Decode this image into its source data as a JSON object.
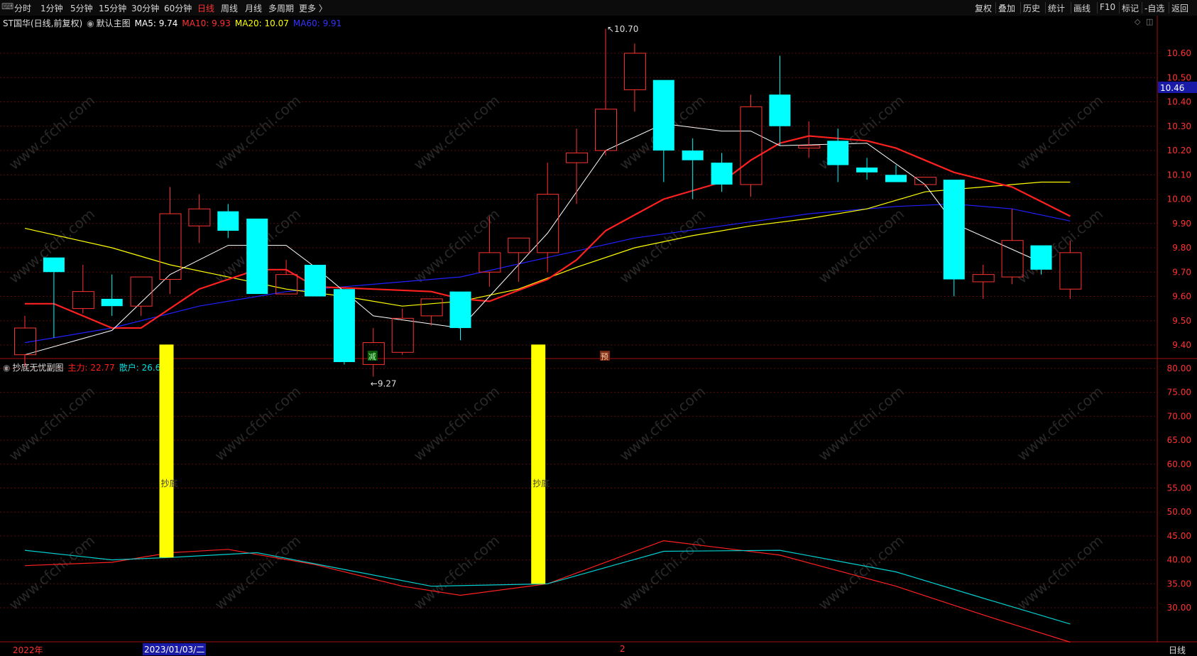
{
  "toolbar": {
    "periods": [
      "分时",
      "1分钟",
      "5分钟",
      "15分钟",
      "30分钟",
      "60分钟",
      "日线",
      "周线",
      "月线",
      "多周期",
      "更多 〉"
    ],
    "active_period": "日线",
    "right_buttons": [
      "复权",
      "叠加",
      "历史",
      "统计",
      "画线",
      "F10",
      "标记",
      "-自选",
      "返回"
    ]
  },
  "main_header": {
    "title": "ST国华(日线,前复权)",
    "chart_name": "默认主图",
    "ma5": "MA5: 9.74",
    "ma10": "MA10: 9.93",
    "ma20": "MA20: 10.07",
    "ma60": "MA60: 9.91"
  },
  "sub_header": {
    "title": "抄底无忧副图",
    "main_force": "主力: 22.77",
    "retail": "散户: 26.62"
  },
  "main_axis_ticks": [
    "10.60",
    "10.50",
    "10.40",
    "10.30",
    "10.20",
    "10.10",
    "10.00",
    "9.90",
    "9.80",
    "9.70",
    "9.60",
    "9.50",
    "9.40"
  ],
  "current_price": "10.46",
  "sub_axis_ticks": [
    "80.00",
    "75.00",
    "70.00",
    "65.00",
    "60.00",
    "55.00",
    "50.00",
    "45.00",
    "40.00",
    "35.00",
    "30.00"
  ],
  "annotations": {
    "high": "10.70",
    "low": "9.27",
    "marker_jian": "减",
    "marker_yu": "预",
    "signal_label": "抄底"
  },
  "date_axis": {
    "year": "2022年",
    "cursor_date": "2023/01/03/二",
    "month": "2"
  },
  "bottom_tab": "日线",
  "watermark": "www.cfchi.com",
  "colors": {
    "up": "#ff3232",
    "down": "#00ffff",
    "ma5": "#ffffff",
    "ma10": "#ff2020",
    "ma20": "#ffff00",
    "ma60": "#2020ff",
    "signal": "#ffff00"
  },
  "chart_data": {
    "type": "candlestick",
    "candles": [
      {
        "o": 9.36,
        "c": 9.47,
        "h": 9.52,
        "l": 9.31
      },
      {
        "o": 9.76,
        "c": 9.7,
        "h": 9.76,
        "l": 9.43
      },
      {
        "o": 9.55,
        "c": 9.62,
        "h": 9.73,
        "l": 9.53
      },
      {
        "o": 9.59,
        "c": 9.56,
        "h": 9.69,
        "l": 9.52
      },
      {
        "o": 9.56,
        "c": 9.68,
        "h": 9.68,
        "l": 9.52
      },
      {
        "o": 9.67,
        "c": 9.94,
        "h": 10.05,
        "l": 9.61
      },
      {
        "o": 9.89,
        "c": 9.96,
        "h": 10.02,
        "l": 9.82
      },
      {
        "o": 9.95,
        "c": 9.87,
        "h": 9.98,
        "l": 9.84
      },
      {
        "o": 9.92,
        "c": 9.61,
        "h": 9.92,
        "l": 9.61
      },
      {
        "o": 9.61,
        "c": 9.69,
        "h": 9.75,
        "l": 9.61
      },
      {
        "o": 9.73,
        "c": 9.6,
        "h": 9.73,
        "l": 9.6
      },
      {
        "o": 9.63,
        "c": 9.33,
        "h": 9.63,
        "l": 9.32
      },
      {
        "o": 9.32,
        "c": 9.41,
        "h": 9.47,
        "l": 9.27
      },
      {
        "o": 9.37,
        "c": 9.51,
        "h": 9.55,
        "l": 9.36
      },
      {
        "o": 9.52,
        "c": 9.59,
        "h": 9.59,
        "l": 9.48
      },
      {
        "o": 9.62,
        "c": 9.47,
        "h": 9.62,
        "l": 9.42
      },
      {
        "o": 9.7,
        "c": 9.78,
        "h": 9.93,
        "l": 9.64
      },
      {
        "o": 9.78,
        "c": 9.84,
        "h": 9.84,
        "l": 9.66
      },
      {
        "o": 9.78,
        "c": 10.02,
        "h": 10.15,
        "l": 9.7
      },
      {
        "o": 10.15,
        "c": 10.19,
        "h": 10.29,
        "l": 9.98
      },
      {
        "o": 10.2,
        "c": 10.37,
        "h": 10.7,
        "l": 10.18
      },
      {
        "o": 10.45,
        "c": 10.6,
        "h": 10.64,
        "l": 10.36
      },
      {
        "o": 10.49,
        "c": 10.2,
        "h": 10.49,
        "l": 10.07
      },
      {
        "o": 10.2,
        "c": 10.16,
        "h": 10.25,
        "l": 10.0
      },
      {
        "o": 10.15,
        "c": 10.06,
        "h": 10.19,
        "l": 10.03
      },
      {
        "o": 10.06,
        "c": 10.38,
        "h": 10.43,
        "l": 10.01
      },
      {
        "o": 10.43,
        "c": 10.3,
        "h": 10.59,
        "l": 10.22
      },
      {
        "o": 10.21,
        "c": 10.22,
        "h": 10.32,
        "l": 10.17
      },
      {
        "o": 10.24,
        "c": 10.14,
        "h": 10.29,
        "l": 10.07
      },
      {
        "o": 10.13,
        "c": 10.11,
        "h": 10.17,
        "l": 10.08
      },
      {
        "o": 10.1,
        "c": 10.07,
        "h": 10.14,
        "l": 10.07
      },
      {
        "o": 10.06,
        "c": 10.09,
        "h": 10.09,
        "l": 10.05
      },
      {
        "o": 10.08,
        "c": 9.67,
        "h": 10.08,
        "l": 9.6
      },
      {
        "o": 9.66,
        "c": 9.69,
        "h": 9.73,
        "l": 9.59
      },
      {
        "o": 9.68,
        "c": 9.83,
        "h": 9.96,
        "l": 9.65
      },
      {
        "o": 9.81,
        "c": 9.71,
        "h": 9.81,
        "l": 9.69
      },
      {
        "o": 9.63,
        "c": 9.78,
        "h": 9.83,
        "l": 9.59
      }
    ],
    "ma5": [
      [
        0,
        9.36
      ],
      [
        3,
        9.46
      ],
      [
        5,
        9.69
      ],
      [
        7,
        9.81
      ],
      [
        9,
        9.81
      ],
      [
        10,
        9.72
      ],
      [
        12,
        9.52
      ],
      [
        15,
        9.47
      ],
      [
        16,
        9.6
      ],
      [
        18,
        9.86
      ],
      [
        20,
        10.2
      ],
      [
        22,
        10.31
      ],
      [
        24,
        10.28
      ],
      [
        25,
        10.28
      ],
      [
        26,
        10.22
      ],
      [
        29,
        10.23
      ],
      [
        31,
        10.06
      ],
      [
        32,
        9.9
      ],
      [
        35,
        9.74
      ]
    ],
    "ma10": [
      [
        0,
        9.57
      ],
      [
        1,
        9.57
      ],
      [
        3,
        9.47
      ],
      [
        4,
        9.47
      ],
      [
        6,
        9.63
      ],
      [
        8,
        9.71
      ],
      [
        9,
        9.71
      ],
      [
        10,
        9.64
      ],
      [
        12,
        9.63
      ],
      [
        14,
        9.62
      ],
      [
        15,
        9.59
      ],
      [
        16,
        9.58
      ],
      [
        18,
        9.67
      ],
      [
        19,
        9.75
      ],
      [
        20,
        9.87
      ],
      [
        22,
        10.0
      ],
      [
        24,
        10.07
      ],
      [
        25,
        10.16
      ],
      [
        26,
        10.23
      ],
      [
        27,
        10.26
      ],
      [
        29,
        10.24
      ],
      [
        30,
        10.21
      ],
      [
        31,
        10.16
      ],
      [
        32,
        10.11
      ],
      [
        33,
        10.08
      ],
      [
        34,
        10.05
      ],
      [
        35,
        9.99
      ],
      [
        36,
        9.93
      ]
    ],
    "ma20": [
      [
        0,
        9.88
      ],
      [
        3,
        9.8
      ],
      [
        5,
        9.73
      ],
      [
        7,
        9.68
      ],
      [
        9,
        9.63
      ],
      [
        11,
        9.6
      ],
      [
        13,
        9.56
      ],
      [
        15,
        9.58
      ],
      [
        17,
        9.63
      ],
      [
        19,
        9.72
      ],
      [
        21,
        9.8
      ],
      [
        23,
        9.85
      ],
      [
        25,
        9.89
      ],
      [
        27,
        9.92
      ],
      [
        29,
        9.96
      ],
      [
        31,
        10.03
      ],
      [
        33,
        10.05
      ],
      [
        35,
        10.07
      ],
      [
        36,
        10.07
      ]
    ],
    "ma60": [
      [
        0,
        9.41
      ],
      [
        3,
        9.47
      ],
      [
        6,
        9.56
      ],
      [
        9,
        9.62
      ],
      [
        12,
        9.65
      ],
      [
        15,
        9.68
      ],
      [
        18,
        9.76
      ],
      [
        21,
        9.84
      ],
      [
        24,
        9.89
      ],
      [
        27,
        9.94
      ],
      [
        30,
        9.97
      ],
      [
        32,
        9.98
      ],
      [
        34,
        9.96
      ],
      [
        36,
        9.91
      ]
    ],
    "sub_main_force": [
      [
        0,
        38.8
      ],
      [
        3,
        39.5
      ],
      [
        5,
        41.5
      ],
      [
        7,
        42.2
      ],
      [
        10,
        39.0
      ],
      [
        13,
        34.5
      ],
      [
        15,
        32.6
      ],
      [
        18,
        35.0
      ],
      [
        22,
        44.0
      ],
      [
        26,
        41.0
      ],
      [
        30,
        34.5
      ],
      [
        33,
        28.5
      ],
      [
        36,
        22.8
      ]
    ],
    "sub_retail": [
      [
        0,
        42.0
      ],
      [
        3,
        40.0
      ],
      [
        5,
        40.5
      ],
      [
        8,
        41.5
      ],
      [
        11,
        38.0
      ],
      [
        14,
        34.5
      ],
      [
        18,
        35.0
      ],
      [
        22,
        41.8
      ],
      [
        26,
        42.0
      ],
      [
        30,
        37.5
      ],
      [
        33,
        32.0
      ],
      [
        36,
        26.6
      ]
    ],
    "signal_bars": [
      {
        "index": 5,
        "from": 40.5,
        "to": 85.0
      },
      {
        "index": 18,
        "from": 35.0,
        "to": 85.0
      }
    ],
    "main_ylim": [
      9.25,
      10.73
    ],
    "sub_ylim": [
      22,
      85
    ]
  }
}
